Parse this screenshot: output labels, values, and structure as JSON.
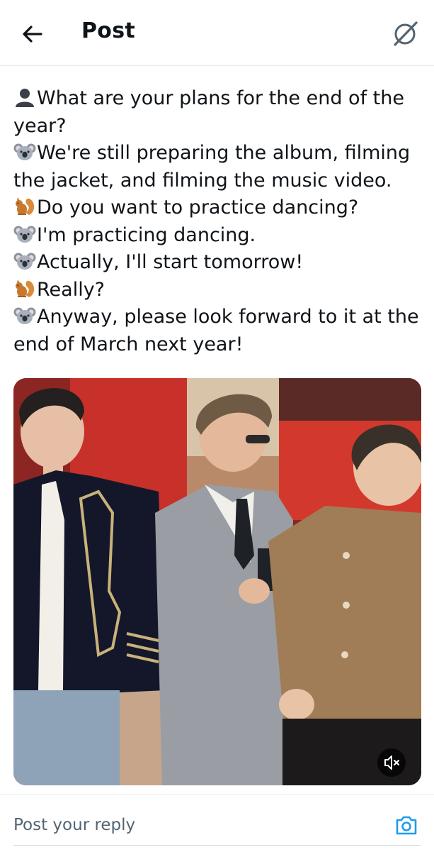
{
  "header": {
    "title": "Post"
  },
  "post": {
    "lines": [
      {
        "emoji": "person-silhouette-icon",
        "text": "What are your plans for the end of the year?"
      },
      {
        "emoji": "koala-icon",
        "text": "We're still preparing the album, filming the jacket, and filming the music video."
      },
      {
        "emoji": "squirrel-icon",
        "text": "Do you want to practice dancing?"
      },
      {
        "emoji": "koala-icon",
        "text": "I'm practicing dancing."
      },
      {
        "emoji": "koala-icon",
        "text": "Actually, I'll start tomorrow!"
      },
      {
        "emoji": "squirrel-icon",
        "text": "Really?"
      },
      {
        "emoji": "koala-icon",
        "text": "Anyway, please look forward to it at the end of March next year!"
      }
    ]
  },
  "media": {
    "type": "video",
    "muted": true
  },
  "reply": {
    "placeholder": "Post your reply"
  },
  "colors": {
    "accent": "#1d9bf0",
    "text": "#0f1419",
    "muted": "#536471"
  }
}
